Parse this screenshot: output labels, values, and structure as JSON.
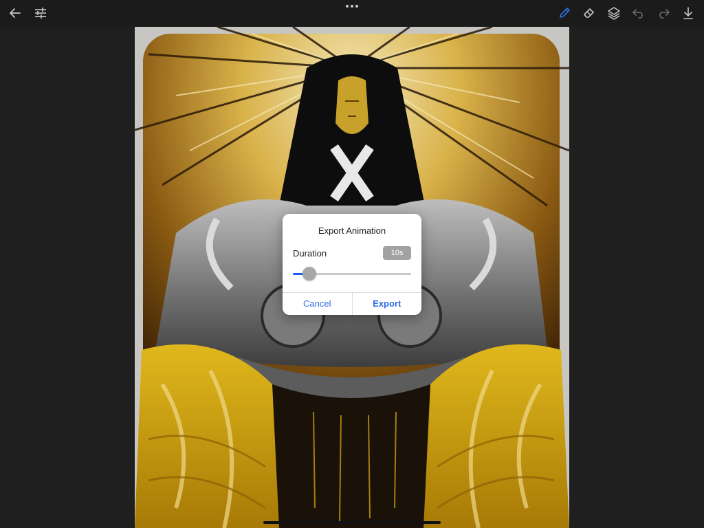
{
  "app": {
    "toolbar": {
      "left_icons": [
        "back-arrow-icon",
        "sliders-icon"
      ],
      "center_icon": "more-dots-icon",
      "right_icons": [
        "pencil-icon",
        "eraser-icon",
        "layers-icon",
        "undo-icon",
        "redo-icon",
        "download-icon"
      ],
      "active_tool": "pencil-icon",
      "accent_color": "#2f6ee6"
    },
    "canvas": {
      "artwork_description_icon": "painting-artwork"
    }
  },
  "dialog": {
    "title": "Export Animation",
    "duration_label": "Duration",
    "duration_value": "10s",
    "slider_fraction": 0.14,
    "cancel_label": "Cancel",
    "export_label": "Export",
    "slider_color": "#1d5cf5"
  }
}
